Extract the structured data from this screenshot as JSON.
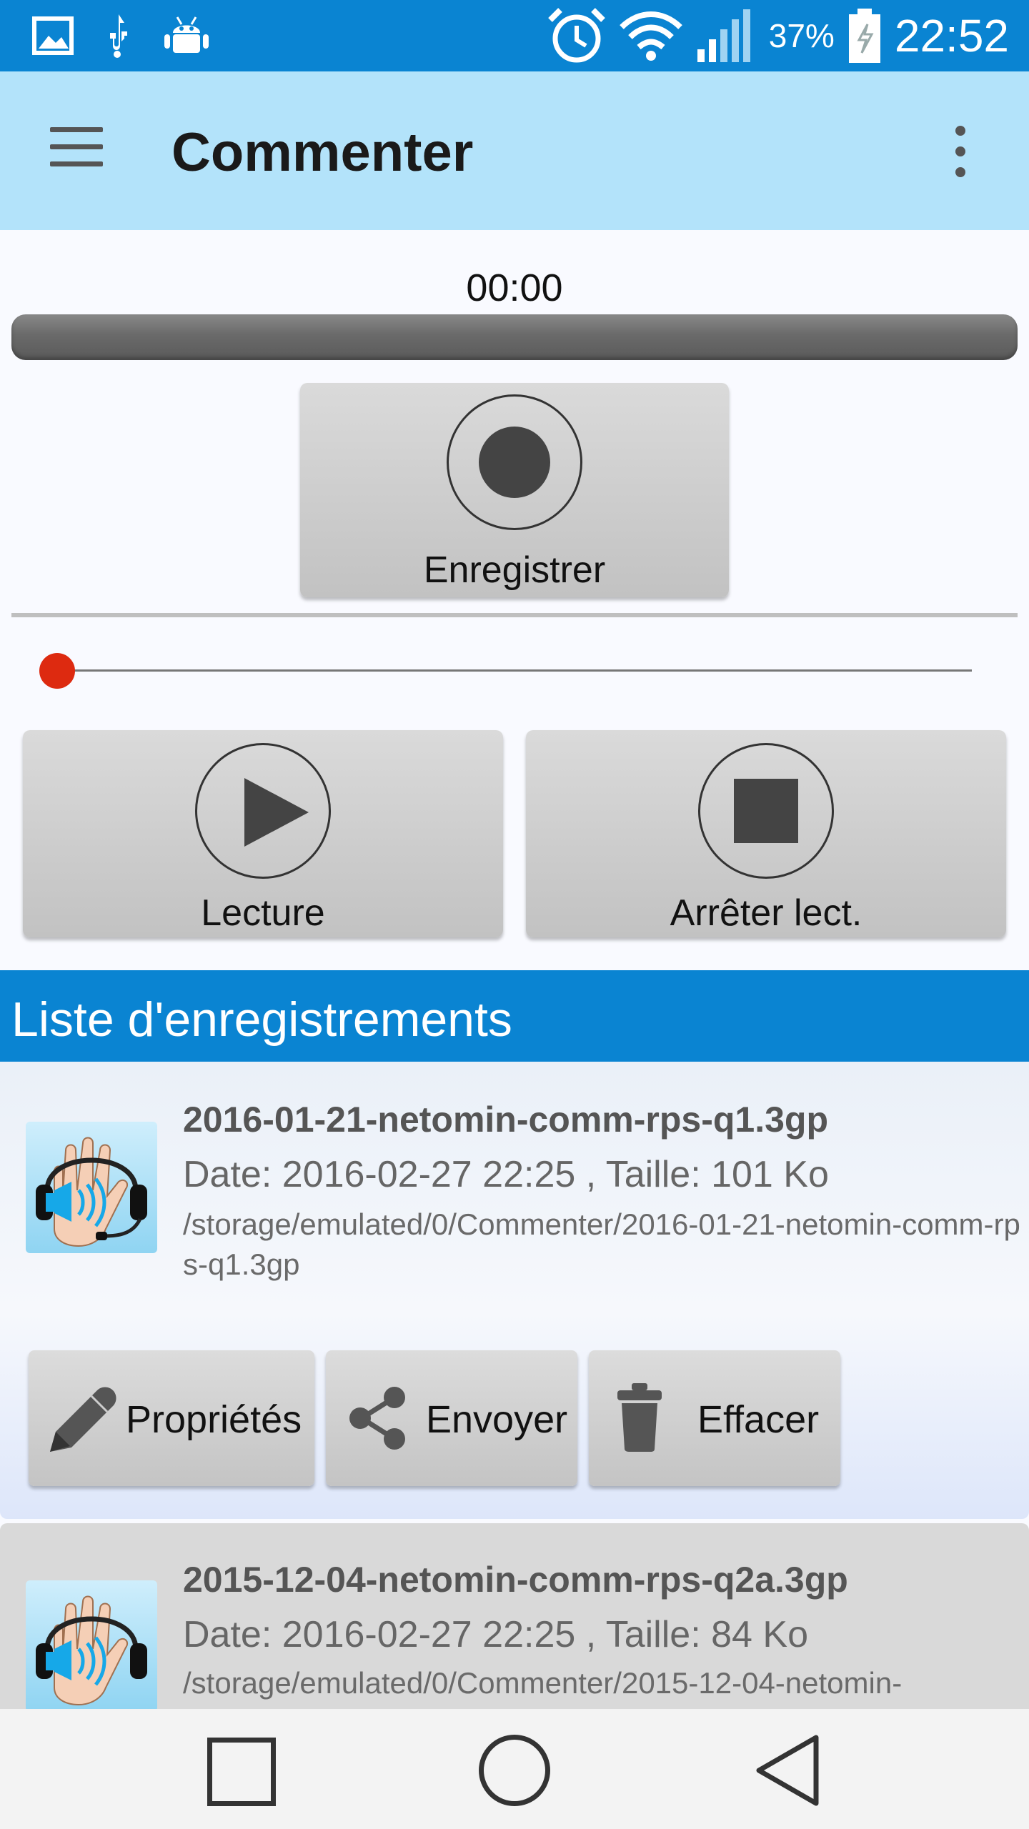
{
  "status_bar": {
    "battery": "37%",
    "time": "22:52",
    "icons": [
      "image-icon",
      "usb-icon",
      "debug-icon",
      "alarm-icon",
      "wifi-icon",
      "signal-icon",
      "battery-icon"
    ]
  },
  "app_bar": {
    "title": "Commenter",
    "icons": [
      "menu-icon",
      "overflow-icon"
    ]
  },
  "recorder": {
    "timer": "00:00",
    "record_label": "Enregistrer",
    "playback_position": 0
  },
  "player": {
    "play_label": "Lecture",
    "stop_label": "Arrêter lect."
  },
  "list": {
    "header": "Liste d'enregistrements",
    "items": [
      {
        "name": "2016-01-21-netomin-comm-rps-q1.3gp",
        "meta": "Date: 2016-02-27 22:25 , Taille: 101 Ko",
        "path": "/storage/emulated/0/Commenter/2016-01-21-netomin-comm-rps-q1.3gp",
        "actions": {
          "properties": "Propriétés",
          "send": "Envoyer",
          "delete": "Effacer"
        }
      },
      {
        "name": "2015-12-04-netomin-comm-rps-q2a.3gp",
        "meta": "Date: 2016-02-27 22:25 , Taille: 84 Ko",
        "path": "/storage/emulated/0/Commenter/2015-12-04-netomin-"
      }
    ]
  },
  "colors": {
    "status_bar": "#0a84d2",
    "app_bar": "#b3e3fa",
    "list_header": "#0a84d2",
    "seek_thumb": "#dd2a10"
  }
}
